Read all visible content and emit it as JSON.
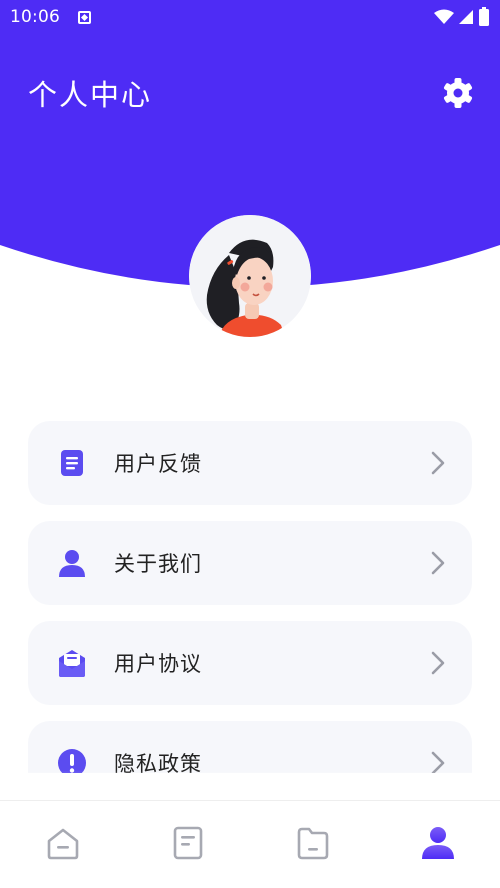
{
  "status_bar": {
    "time": "10:06",
    "icons": [
      "app-notification-icon",
      "wifi-icon",
      "cell-signal-icon",
      "battery-icon"
    ]
  },
  "header": {
    "title": "个人中心",
    "settings_icon": "gear-icon",
    "avatar": "avatar-girl-illustration"
  },
  "colors": {
    "primary": "#4e2cf5",
    "card_bg": "#f6f7fb",
    "icon_accent": "#5b4cf0",
    "nav_inactive": "#a7a9b2"
  },
  "menu": {
    "items": [
      {
        "label": "用户反馈",
        "icon": "feedback-document-icon"
      },
      {
        "label": "关于我们",
        "icon": "person-icon"
      },
      {
        "label": "用户协议",
        "icon": "envelope-icon"
      },
      {
        "label": "隐私政策",
        "icon": "exclamation-circle-icon"
      }
    ]
  },
  "bottom_nav": {
    "tabs": [
      {
        "name": "home",
        "icon": "home-icon",
        "active": false
      },
      {
        "name": "notes",
        "icon": "document-icon",
        "active": false
      },
      {
        "name": "folder",
        "icon": "folder-icon",
        "active": false
      },
      {
        "name": "profile",
        "icon": "profile-icon",
        "active": true
      }
    ]
  }
}
